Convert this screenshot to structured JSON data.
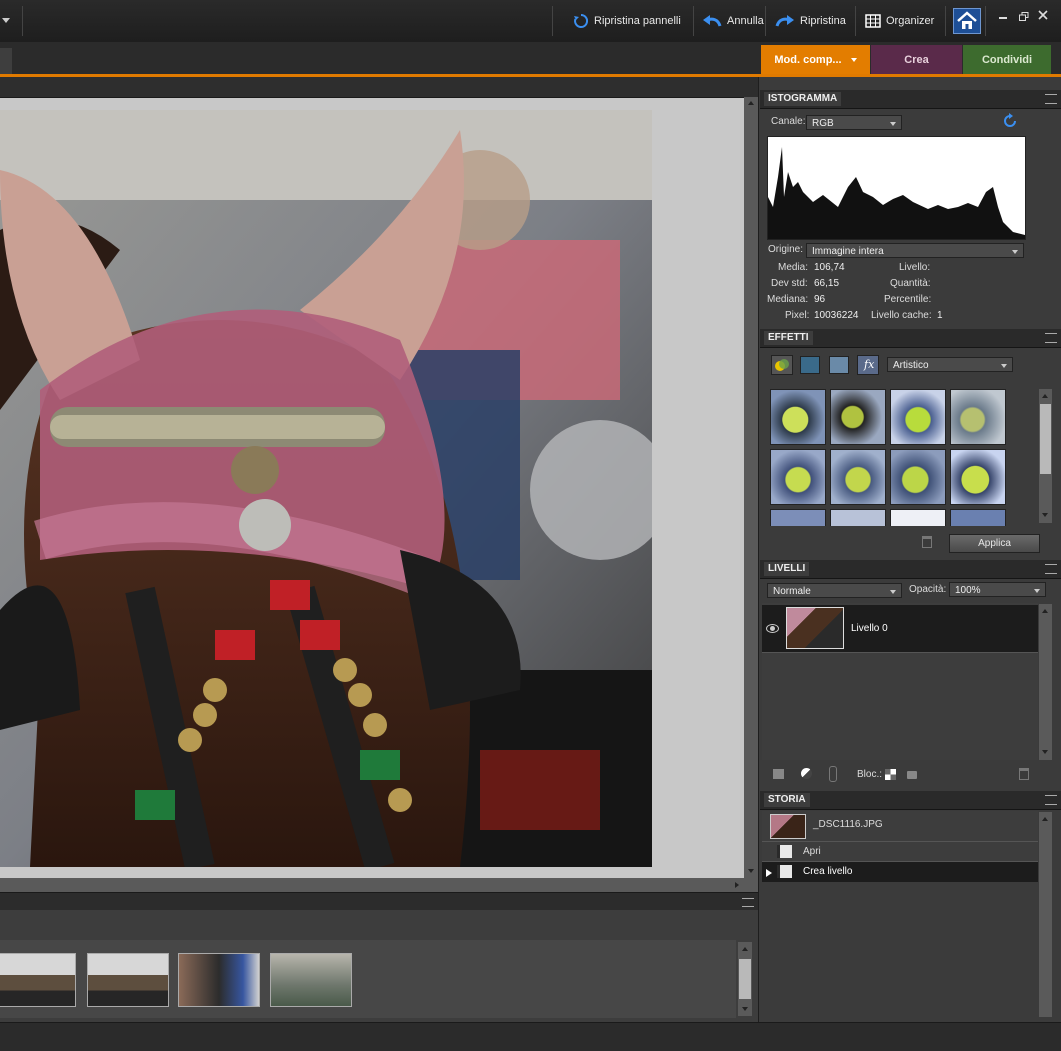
{
  "topbar": {
    "reset_panels": "Ripristina pannelli",
    "undo": "Annulla",
    "redo": "Ripristina",
    "organizer": "Organizer"
  },
  "modes": {
    "edit": "Mod. comp...",
    "create": "Crea",
    "share": "Condividi"
  },
  "histogram": {
    "title": "ISTOGRAMMA",
    "channel_label": "Canale:",
    "channel_value": "RGB",
    "source_label": "Origine:",
    "source_value": "Immagine intera",
    "mean_label": "Media:",
    "mean_value": "106,74",
    "stddev_label": "Dev std:",
    "stddev_value": "66,15",
    "median_label": "Mediana:",
    "median_value": "96",
    "pixels_label": "Pixel:",
    "pixels_value": "10036224",
    "level_label": "Livello:",
    "count_label": "Quantità:",
    "percentile_label": "Percentile:",
    "cache_label": "Livello cache:",
    "cache_value": "1"
  },
  "effects": {
    "title": "EFFETTI",
    "category": "Artistico",
    "apply_label": "Applica"
  },
  "layers": {
    "title": "LIVELLI",
    "blend_mode": "Normale",
    "opacity_label": "Opacità:",
    "opacity_value": "100%",
    "layer_name": "Livello 0",
    "lock_label": "Bloc.:"
  },
  "history": {
    "title": "STORIA",
    "file_name": "_DSC1116.JPG",
    "steps": [
      "Apri",
      "Crea livello"
    ]
  },
  "colors": {
    "accent_orange": "#e07a00",
    "create_tab": "#5a2a4a",
    "share_tab": "#3d6b2e"
  }
}
